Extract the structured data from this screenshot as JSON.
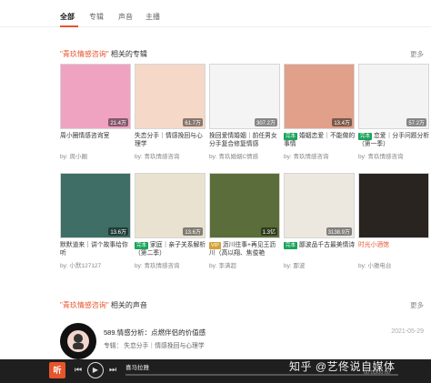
{
  "tabs": [
    {
      "label": "全部"
    },
    {
      "label": "专辑"
    },
    {
      "label": "声音"
    },
    {
      "label": "主播"
    }
  ],
  "albums_section": {
    "query": "\"青玖情感咨询\"",
    "label": "相关的专辑",
    "more": "更多"
  },
  "albums": [
    {
      "title": "周小圈情感咨询室",
      "badge": "",
      "author": "by:  周小圈",
      "count": "21.4万",
      "color": "#f0a3c0"
    },
    {
      "title": "失恋分手｜情感挽回与心理学",
      "badge": "",
      "author": "by:  青玖情感咨询",
      "count": "61.7万",
      "color": "#f5d8c8"
    },
    {
      "title": "挽回爱情婚姻｜前任男女分手复合修复情感",
      "badge": "",
      "author": "by:  青玖婚姻C情感",
      "count": "307.2万",
      "color": "#f4f4f4"
    },
    {
      "title": "婚姻恋爱｜不能做的事情",
      "badge": "完本",
      "author": "by:  青玖情感咨询",
      "count": "13.4万",
      "color": "#e0a08a"
    },
    {
      "title": "恋爱｜分手问题分析（第一季）",
      "badge": "完本",
      "author": "by:  青玖情感咨询",
      "count": "57.2万",
      "color": "#f3f3f3"
    },
    {
      "title": "默默道来｜讲个故事给你听",
      "badge": "",
      "author": "by:  小默127127",
      "count": "13.6万",
      "color": "#3e6e66"
    },
    {
      "title": "家庭｜亲子关系解析（第二季）",
      "badge": "完本",
      "author": "by:  青玖情感咨询",
      "count": "13.6万",
      "color": "#e9e2d0"
    },
    {
      "title": "沥川往事+再见王沥川（高以翔、焦俊艳",
      "badge": "VIP",
      "author": "by:  李满超",
      "count": "1.3亿",
      "color": "#5a6d3a"
    },
    {
      "title": "鄙波品千古最美情诗",
      "badge": "完本",
      "author": "by:  鄙波",
      "count": "3138.9万",
      "color": "#ece8e0"
    },
    {
      "title": "时光小酒馆",
      "badge": "",
      "author": "by:  小雅电台",
      "count": "",
      "color": "#2a2420"
    }
  ],
  "tracks_section": {
    "query": "\"青玖情感咨询\"",
    "label": "相关的声音",
    "more": "更多"
  },
  "track": {
    "title": "589.情感分析：点燃伴侣的价值感",
    "album": "专辑：  失恋分手｜情感挽回与心理学",
    "date": "2021-05-29"
  },
  "watermark": "知乎 @艺佟说自媒体",
  "player": {
    "logo": "听",
    "track": "喜马拉雅",
    "time": "00:00/00:00",
    "progress": 0.0
  },
  "colors": {
    "accent": "#e8542c",
    "badge": "#1aa35a"
  }
}
